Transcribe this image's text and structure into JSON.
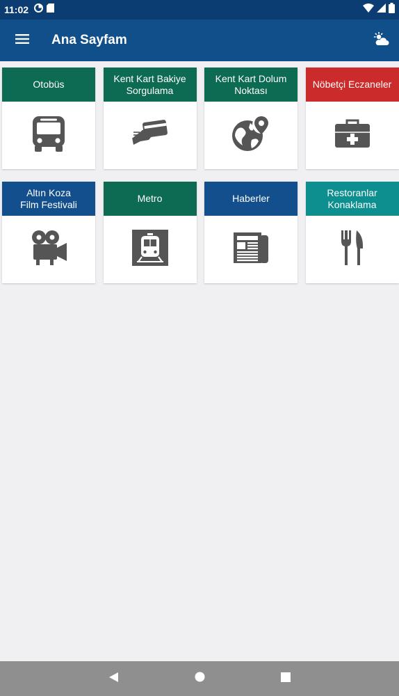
{
  "status_bar": {
    "time": "11:02",
    "icons_left": [
      "data-saver-icon",
      "sd-card-icon"
    ],
    "icons_right": [
      "wifi-icon",
      "signal-icon",
      "battery-icon"
    ]
  },
  "app_bar": {
    "title": "Ana Sayfam",
    "menu_icon": "menu-icon",
    "action_icon": "weather-icon"
  },
  "tiles": [
    {
      "label": "Otobüs",
      "icon": "bus-icon",
      "color": "#0d6b53"
    },
    {
      "label": "Kent Kart Bakiye\nSorgulama",
      "icon": "card-payment-icon",
      "color": "#0d6b53"
    },
    {
      "label": "Kent Kart Dolum\nNoktası",
      "icon": "globe-pin-icon",
      "color": "#0d6b53"
    },
    {
      "label": "Nöbetçi Eczaneler",
      "icon": "first-aid-kit-icon",
      "color": "#cc2b2b"
    },
    {
      "label": "Altın Koza\nFilm Festivali",
      "icon": "film-camera-icon",
      "color": "#134f8c"
    },
    {
      "label": "Metro",
      "icon": "train-icon",
      "color": "#0d6b53"
    },
    {
      "label": "Haberler",
      "icon": "newspaper-icon",
      "color": "#134f8c"
    },
    {
      "label": "Restoranlar\nKonaklama",
      "icon": "cutlery-icon",
      "color": "#0d8f8f"
    }
  ],
  "icon_color": "#555555",
  "nav_bar": {
    "buttons": [
      "back-icon",
      "home-icon",
      "recents-icon"
    ]
  }
}
